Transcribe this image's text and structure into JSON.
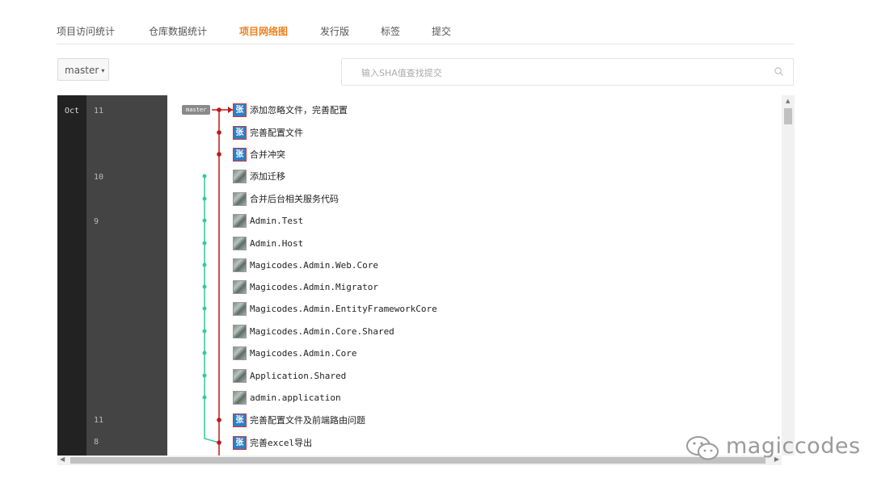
{
  "tabs": [
    {
      "label": "项目访问统计",
      "active": false
    },
    {
      "label": "仓库数据统计",
      "active": false
    },
    {
      "label": "项目网络图",
      "active": true
    },
    {
      "label": "发行版",
      "active": false
    },
    {
      "label": "标签",
      "active": false
    },
    {
      "label": "提交",
      "active": false
    }
  ],
  "branch": {
    "label": "master",
    "caret": "▾"
  },
  "search": {
    "placeholder": "输入SHA值查找提交",
    "value": ""
  },
  "graph": {
    "month": "Oct",
    "master_tag": "master",
    "day_labels": [
      "11",
      "10",
      "9",
      "11",
      "8"
    ],
    "commits": [
      {
        "avatar": "张",
        "message": "添加忽略文件，完善配置"
      },
      {
        "avatar": "张",
        "message": "完善配置文件"
      },
      {
        "avatar": "张",
        "message": "合并冲突"
      },
      {
        "avatar": "",
        "message": "添加迁移"
      },
      {
        "avatar": "",
        "message": "合并后台相关服务代码"
      },
      {
        "avatar": "",
        "message": "Admin.Test"
      },
      {
        "avatar": "",
        "message": "Admin.Host"
      },
      {
        "avatar": "",
        "message": "Magicodes.Admin.Web.Core"
      },
      {
        "avatar": "",
        "message": "Magicodes.Admin.Migrator"
      },
      {
        "avatar": "",
        "message": "Magicodes.Admin.EntityFrameworkCore"
      },
      {
        "avatar": "",
        "message": "Magicodes.Admin.Core.Shared"
      },
      {
        "avatar": "",
        "message": "Magicodes.Admin.Core"
      },
      {
        "avatar": "",
        "message": "Application.Shared"
      },
      {
        "avatar": "",
        "message": "admin.application"
      },
      {
        "avatar": "张",
        "message": "完善配置文件及前端路由问题"
      },
      {
        "avatar": "张",
        "message": "完善excel导出"
      }
    ]
  },
  "colors": {
    "accent": "#f0811e",
    "master_line": "#c0181e",
    "branch_line": "#2ecc9a",
    "avatar_bg": "#2f7fc6"
  },
  "watermark": {
    "text": "magiccodes",
    "icon": "wechat-icon"
  }
}
